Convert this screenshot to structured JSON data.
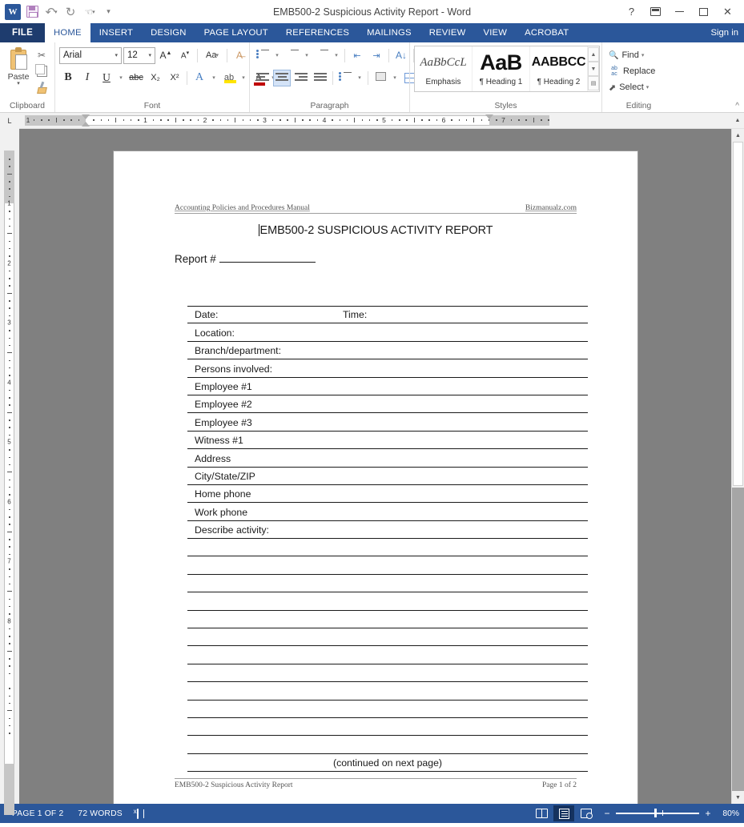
{
  "titlebar": {
    "document_title": "EMB500-2 Suspicious Activity Report - Word",
    "quick_access": [
      {
        "name": "word-logo",
        "label": "W"
      },
      {
        "name": "save",
        "label": "Save"
      },
      {
        "name": "undo",
        "label": "Undo"
      },
      {
        "name": "redo",
        "label": "Redo"
      },
      {
        "name": "touch-mode",
        "label": "Touch/Mouse Mode"
      },
      {
        "name": "customize-qat",
        "label": "Customize Quick Access Toolbar"
      }
    ],
    "help_label": "?",
    "ribbon_display_label": "Ribbon Display Options",
    "minimize_label": "Minimize",
    "restore_label": "Restore Down",
    "close_label": "Close"
  },
  "tabs": {
    "file": "FILE",
    "items": [
      "HOME",
      "INSERT",
      "DESIGN",
      "PAGE LAYOUT",
      "REFERENCES",
      "MAILINGS",
      "REVIEW",
      "VIEW",
      "ACROBAT"
    ],
    "active": "HOME",
    "signin": "Sign in"
  },
  "ribbon": {
    "clipboard": {
      "label": "Clipboard",
      "paste": "Paste",
      "paste_caret": "▾",
      "cut": "Cut",
      "copy": "Copy",
      "format_painter": "Format Painter",
      "dialog_launcher": "◹"
    },
    "font": {
      "label": "Font",
      "font_name": "Arial",
      "font_size": "12",
      "grow_font": "A",
      "shrink_font": "A",
      "change_case": "Aa",
      "clear_formatting": "A",
      "bold": "B",
      "italic": "I",
      "underline": "U",
      "strikethrough": "abc",
      "subscript": "X₂",
      "superscript": "X²",
      "text_effects": "A",
      "highlight": "ab",
      "font_color": "A",
      "dialog_launcher": "◹"
    },
    "paragraph": {
      "label": "Paragraph",
      "bullets": "Bullets",
      "numbering": "Numbering",
      "multilevel": "Multilevel List",
      "decrease_indent": "Decrease Indent",
      "increase_indent": "Increase Indent",
      "sort": "Sort",
      "show_marks": "¶",
      "align_left": "Align Left",
      "align_center": "Center",
      "align_right": "Align Right",
      "justify": "Justify",
      "line_spacing": "Line and Paragraph Spacing",
      "shading": "Shading",
      "borders": "Borders",
      "dialog_launcher": "◹"
    },
    "styles": {
      "label": "Styles",
      "gallery": [
        {
          "preview": "AaBbCcL",
          "name": "Emphasis"
        },
        {
          "preview": "AaB",
          "name": "¶ Heading 1"
        },
        {
          "preview": "AABBCC",
          "name": "¶ Heading 2"
        }
      ],
      "scroll_up": "▲",
      "scroll_down": "▼",
      "more": "▤",
      "dialog_launcher": "◹"
    },
    "editing": {
      "label": "Editing",
      "find": "Find",
      "find_caret": "▾",
      "replace": "Replace",
      "select": "Select",
      "select_caret": "▾"
    },
    "collapse_label": "^"
  },
  "ruler": {
    "tab_selector": "L",
    "horizontal_numbers": [
      "1",
      "2",
      "3",
      "4",
      "5",
      "6",
      "7"
    ],
    "vertical_numbers": [
      "1",
      "2",
      "3",
      "4",
      "5",
      "6",
      "7",
      "8"
    ]
  },
  "document": {
    "header": {
      "left": "Accounting Policies and Procedures Manual",
      "right": "Bizmanualz.com"
    },
    "title": "EMB500-2 SUSPICIOUS ACTIVITY REPORT",
    "report_number_label": "Report #",
    "table_rows": [
      {
        "col1": "Date:",
        "col2": "Time:"
      },
      {
        "col1": "Location:",
        "col2": ""
      },
      {
        "col1": "Branch/department:",
        "col2": ""
      },
      {
        "col1": "Persons involved:",
        "col2": ""
      },
      {
        "col1": "Employee #1",
        "col2": ""
      },
      {
        "col1": "Employee #2",
        "col2": ""
      },
      {
        "col1": "Employee #3",
        "col2": ""
      },
      {
        "col1": "Witness #1",
        "col2": ""
      },
      {
        "col1": "Address",
        "col2": ""
      },
      {
        "col1": "City/State/ZIP",
        "col2": ""
      },
      {
        "col1": "Home phone",
        "col2": ""
      },
      {
        "col1": "Work phone",
        "col2": ""
      },
      {
        "col1": "Describe activity:",
        "col2": ""
      }
    ],
    "blank_line_count": 12,
    "continued_text": "(continued on next page)",
    "footer": {
      "left": "EMB500-2 Suspicious Activity Report",
      "right": "Page 1 of 2"
    }
  },
  "statusbar": {
    "page_indicator": "PAGE 1 OF 2",
    "word_count": "72 WORDS",
    "proofing_label": "Proofing Errors",
    "view_read": "Read Mode",
    "view_print": "Print Layout",
    "view_web": "Web Layout",
    "zoom_out": "−",
    "zoom_in": "+",
    "zoom_level": "80%"
  },
  "colors": {
    "accent": "#2b579a",
    "file_tab": "#1e3c6e",
    "canvas": "#808080",
    "highlight_yellow": "#ffe400",
    "font_color_red": "#c00000"
  }
}
